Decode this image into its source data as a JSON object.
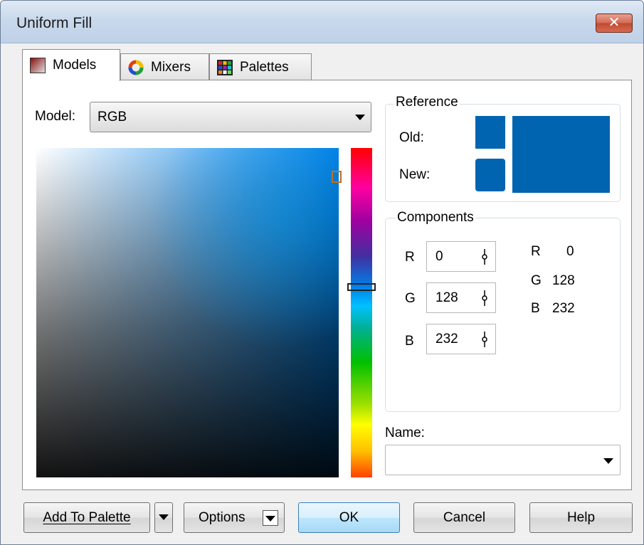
{
  "window": {
    "title": "Uniform Fill",
    "close_symbol": "✕"
  },
  "tabs": [
    {
      "label": "Models",
      "icon": "models-icon",
      "active": true
    },
    {
      "label": "Mixers",
      "icon": "mixers-icon",
      "active": false
    },
    {
      "label": "Palettes",
      "icon": "palettes-icon",
      "active": false
    }
  ],
  "model": {
    "label": "Model:",
    "value": "RGB"
  },
  "reference": {
    "title": "Reference",
    "old_label": "Old:",
    "new_label": "New:",
    "old_color": "#0064b1",
    "new_color": "#0064b1"
  },
  "components": {
    "title": "Components",
    "fields": [
      {
        "letter": "R",
        "value": "0"
      },
      {
        "letter": "G",
        "value": "128"
      },
      {
        "letter": "B",
        "value": "232"
      }
    ],
    "readout": [
      {
        "letter": "R",
        "value": "0"
      },
      {
        "letter": "G",
        "value": "128"
      },
      {
        "letter": "B",
        "value": "232"
      }
    ]
  },
  "name": {
    "label": "Name:",
    "value": ""
  },
  "buttons": {
    "add_to_palette": "Add To Palette",
    "options": "Options",
    "ok": "OK",
    "cancel": "Cancel",
    "help": "Help"
  },
  "colors": {
    "accent": "#0064b1",
    "title_bar": "#c9d9ec",
    "close": "#c14a30"
  }
}
